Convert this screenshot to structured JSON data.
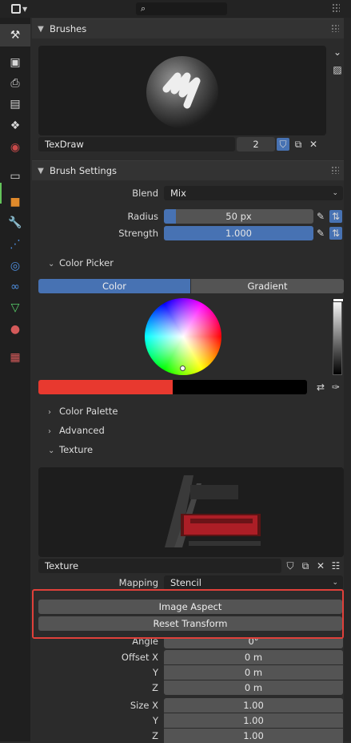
{
  "colors": {
    "accent": "#4772b3",
    "red_swatch": "#e8392f",
    "highlight": "#e0403a"
  },
  "header": {
    "editor_icon": "tool-settings-icon",
    "search_icon": "search-icon"
  },
  "tabs": [
    "tool-icon",
    "render-icon",
    "output-icon",
    "view-layer-icon",
    "scene-icon",
    "world-icon",
    "collection-icon",
    "object-icon",
    "modifier-icon",
    "particles-icon",
    "physics-icon",
    "constraints-icon",
    "data-icon",
    "material-icon",
    "texture-icon"
  ],
  "brushes": {
    "title": "Brushes",
    "name": "TexDraw",
    "users": "2"
  },
  "brush_settings": {
    "title": "Brush Settings",
    "blend_label": "Blend",
    "blend_value": "Mix",
    "radius_label": "Radius",
    "radius_value": "50 px",
    "radius_fraction": 0.08,
    "strength_label": "Strength",
    "strength_value": "1.000",
    "strength_fraction": 1.0
  },
  "color_picker": {
    "title": "Color Picker",
    "tab_color": "Color",
    "tab_gradient": "Gradient"
  },
  "subpanels": {
    "palette": "Color Palette",
    "advanced": "Advanced",
    "texture": "Texture"
  },
  "texture": {
    "name": "Texture",
    "mapping_label": "Mapping",
    "mapping_value": "Stencil",
    "image_aspect": "Image Aspect",
    "reset_transform": "Reset Transform",
    "angle_label": "Angle",
    "angle_value": "0°",
    "offset_x_label": "Offset X",
    "offset_x": "0 m",
    "y_label": "Y",
    "offset_y": "0 m",
    "z_label": "Z",
    "offset_z": "0 m",
    "size_x_label": "Size X",
    "size_x": "1.00",
    "size_y": "1.00",
    "size_z": "1.00"
  }
}
